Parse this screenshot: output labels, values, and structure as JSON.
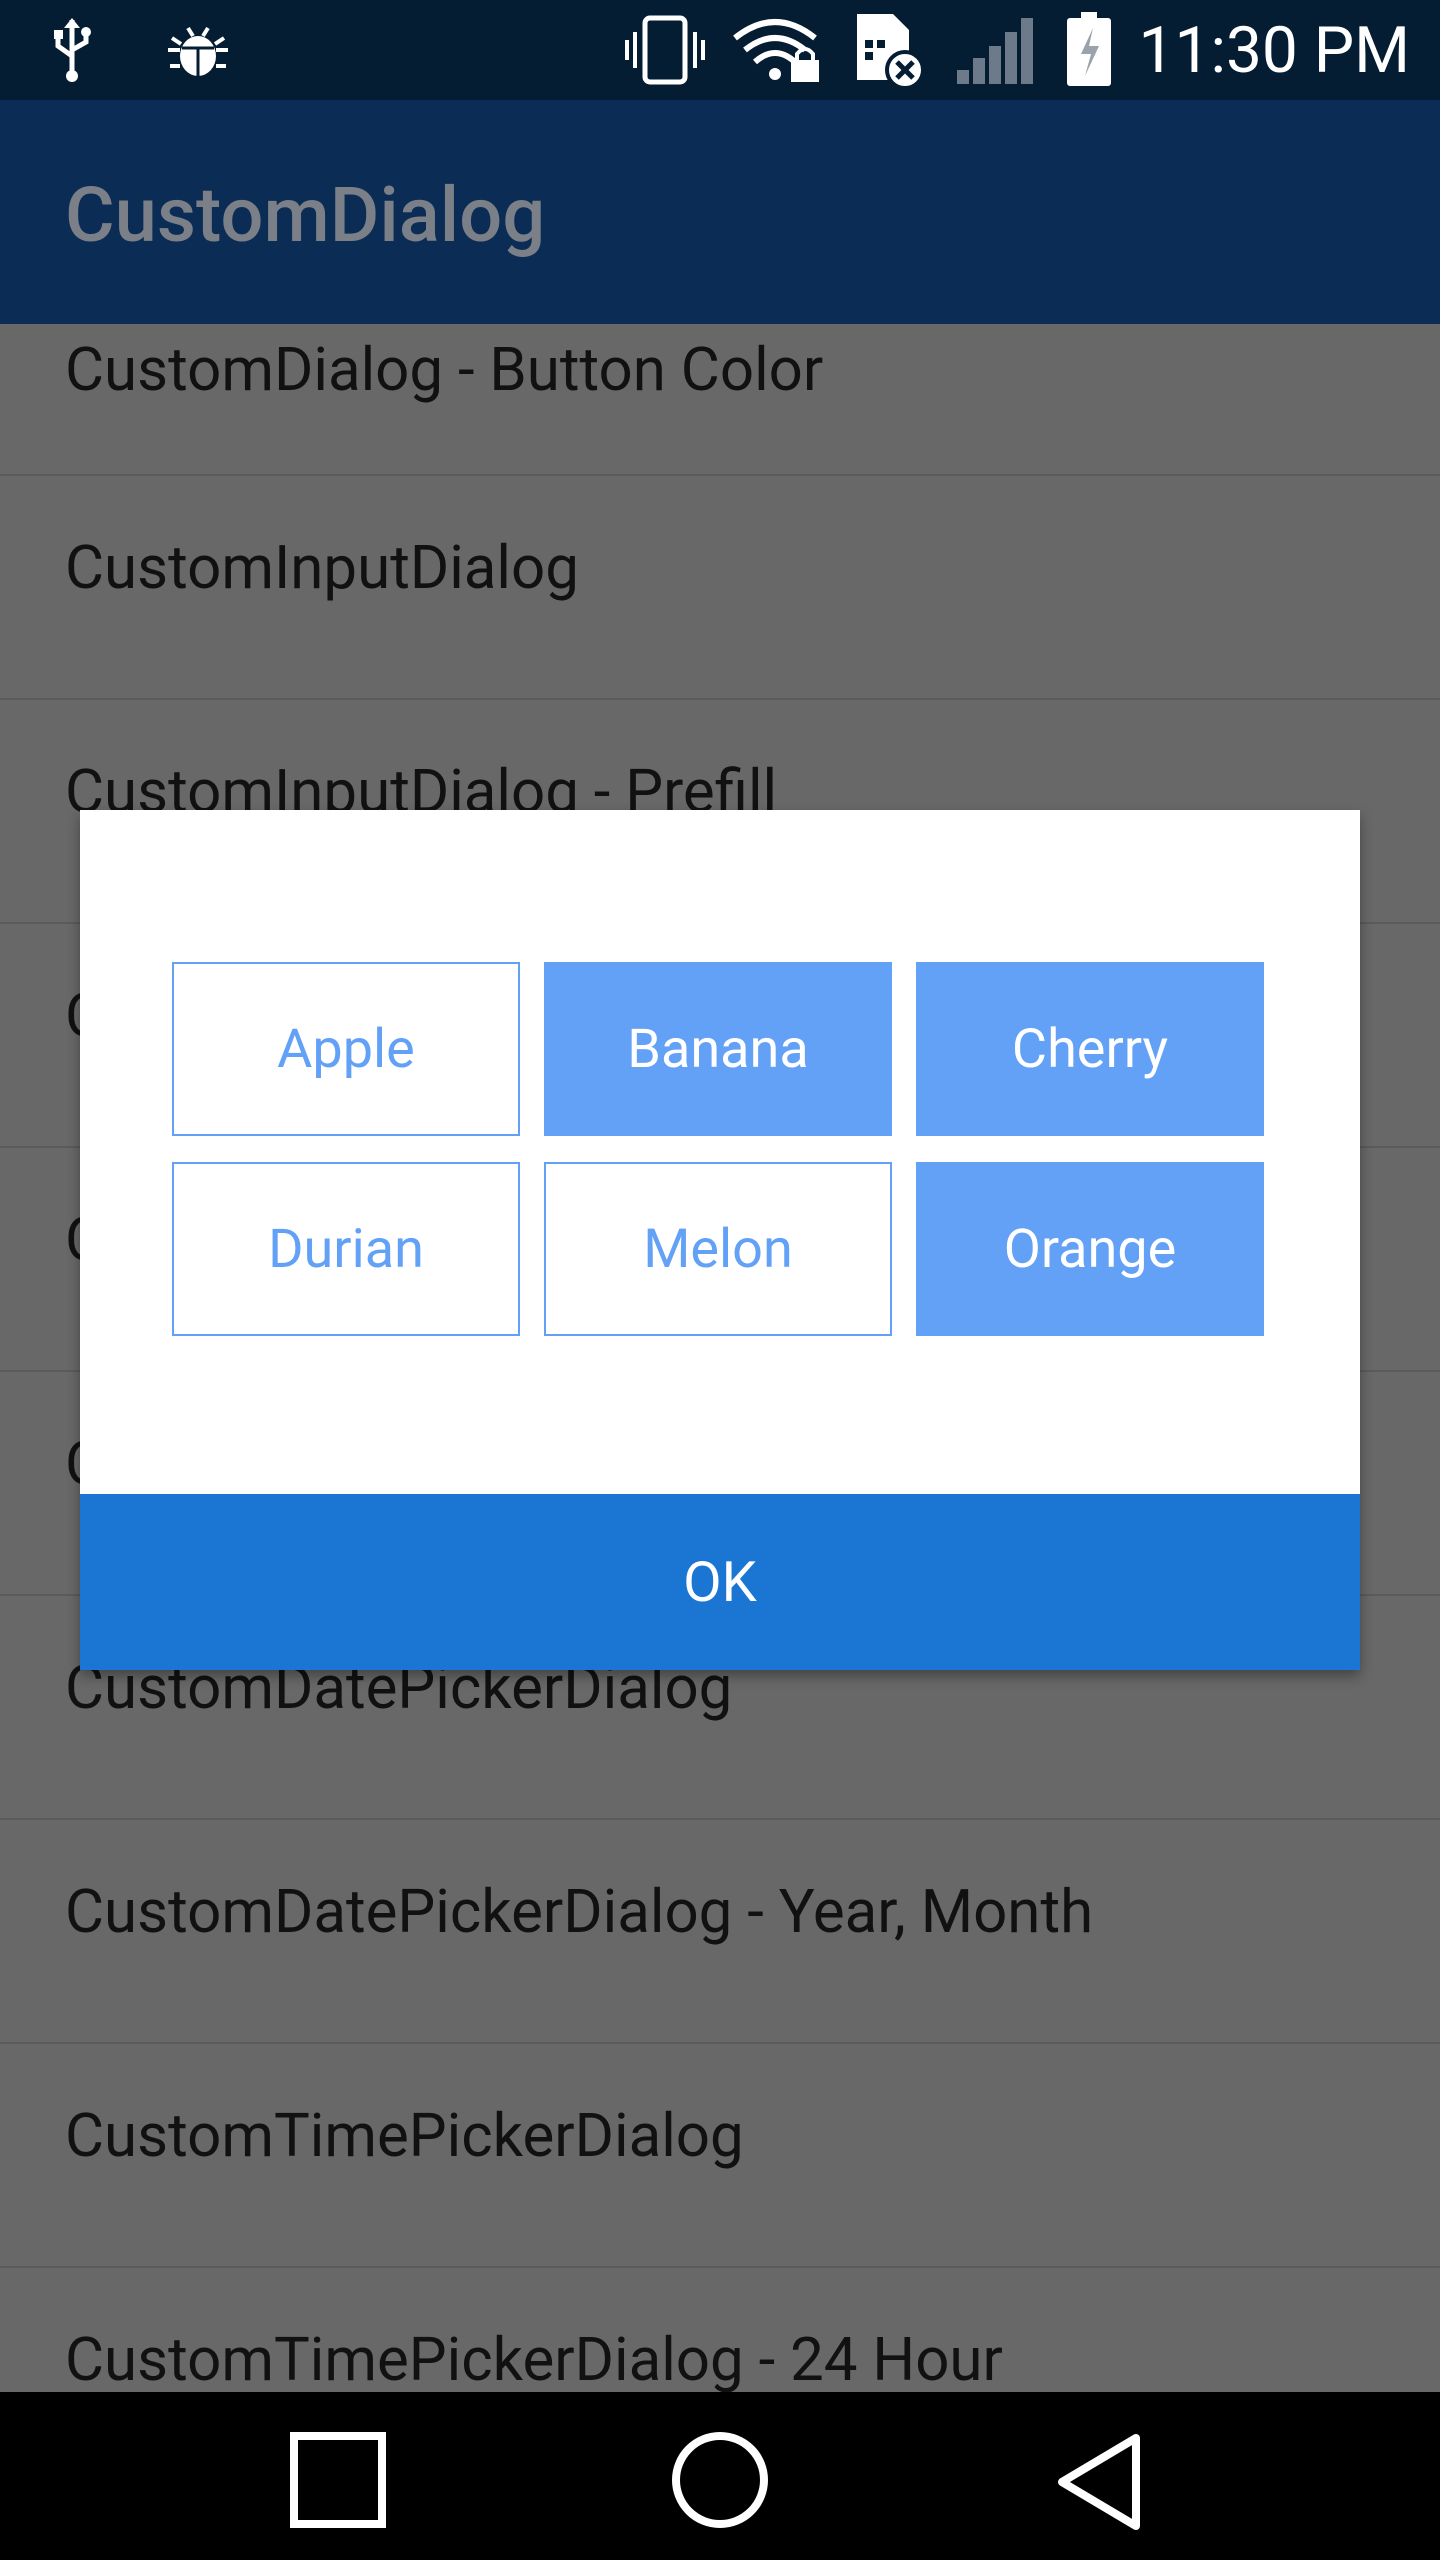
{
  "status_bar": {
    "time": "11:30 PM",
    "icons": [
      "usb-icon",
      "bug-icon",
      "vibrate-icon",
      "wifi-lock-icon",
      "sim-error-icon",
      "signal-icon",
      "battery-icon"
    ]
  },
  "app_bar": {
    "title": "CustomDialog"
  },
  "list": {
    "items": [
      "CustomDialog - Button Color",
      "CustomInputDialog",
      "CustomInputDialog - Prefill",
      "C",
      "C",
      "C",
      "CustomDatePickerDialog",
      "CustomDatePickerDialog - Year, Month",
      "CustomTimePickerDialog",
      "CustomTimePickerDialog - 24 Hour"
    ]
  },
  "dialog": {
    "choices": [
      {
        "label": "Apple",
        "selected": false
      },
      {
        "label": "Banana",
        "selected": true
      },
      {
        "label": "Cherry",
        "selected": true
      },
      {
        "label": "Durian",
        "selected": false
      },
      {
        "label": "Melon",
        "selected": false
      },
      {
        "label": "Orange",
        "selected": true
      }
    ],
    "ok_label": "OK"
  },
  "nav_bar": {
    "buttons": [
      "recents-icon",
      "home-icon",
      "back-icon"
    ]
  },
  "colors": {
    "status_bar": "#041d33",
    "app_bar": "#0b2c55",
    "scrim": "#686868",
    "choice_accent": "#63a1f7",
    "ok_button": "#1a76d2"
  }
}
